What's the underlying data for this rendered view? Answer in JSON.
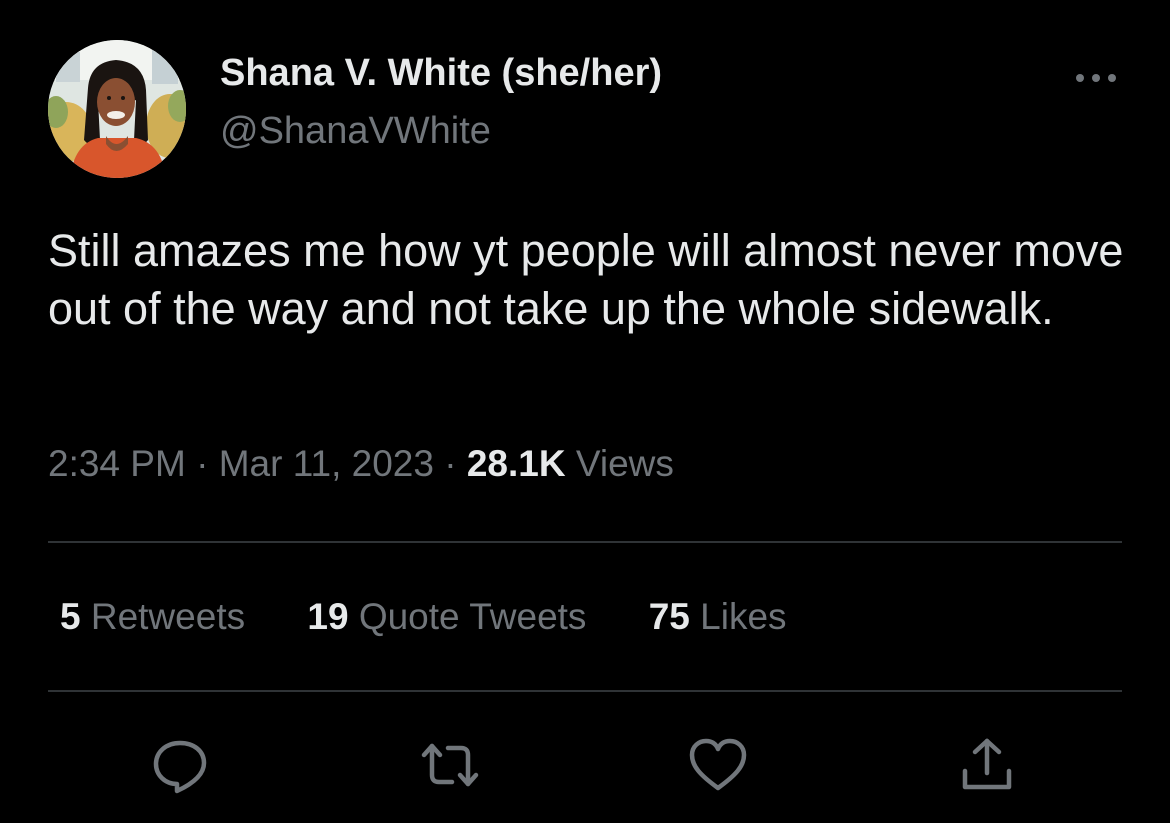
{
  "author": {
    "display_name": "Shana V. White (she/her)",
    "handle": "@ShanaVWhite",
    "avatar_icon": "profile-photo"
  },
  "tweet": {
    "text": "Still amazes me how yt people will almost never move out of the way and not take up the whole sidewalk."
  },
  "meta": {
    "time": "2:34 PM",
    "separator": "·",
    "date": "Mar 11, 2023",
    "views_count": "28.1K",
    "views_label": "Views"
  },
  "stats": {
    "retweets_count": "5",
    "retweets_label": "Retweets",
    "quotes_count": "19",
    "quotes_label": "Quote Tweets",
    "likes_count": "75",
    "likes_label": "Likes"
  },
  "actions": {
    "more_icon": "more-icon",
    "reply_icon": "reply-icon",
    "retweet_icon": "retweet-icon",
    "like_icon": "heart-icon",
    "share_icon": "share-icon"
  },
  "colors": {
    "background": "#000000",
    "primary_text": "#e7e9ea",
    "secondary_text": "#71767b",
    "divider": "#2f3336"
  }
}
